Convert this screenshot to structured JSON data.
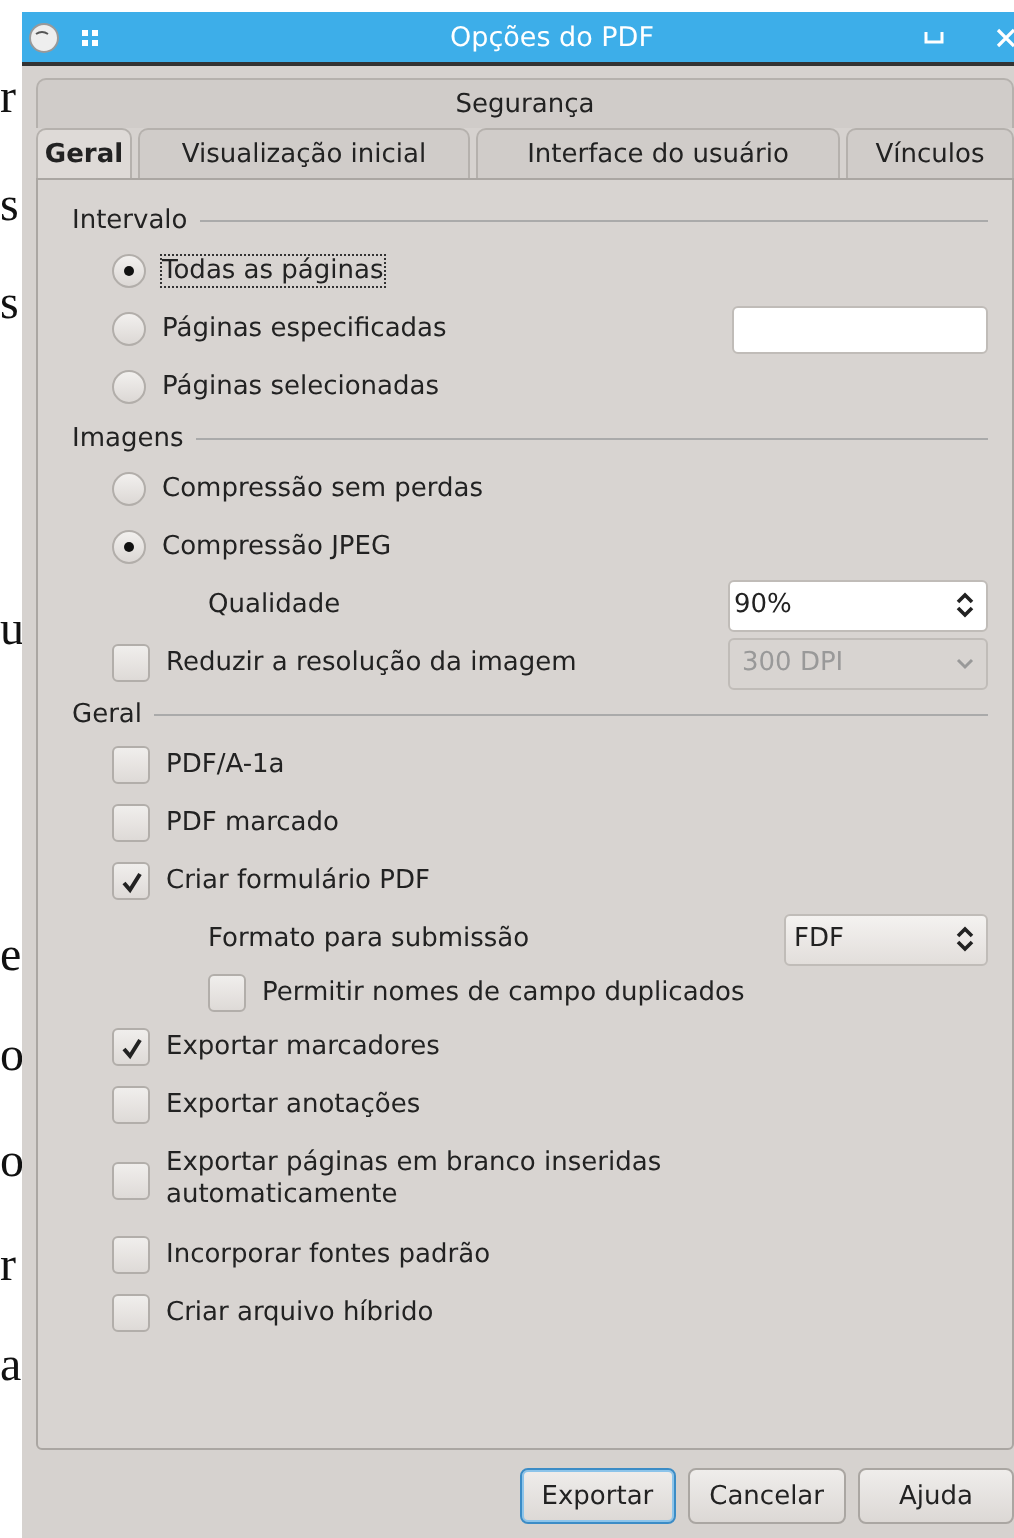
{
  "background_document": {
    "fragments": [
      {
        "text": "r",
        "bold": false
      },
      {
        "text": "s",
        "bold": false
      },
      {
        "text": "s",
        "bold": false
      },
      {
        "text": "u",
        "bold": false
      },
      {
        "text": "e",
        "bold": false
      },
      {
        "text": "o",
        "bold": false
      },
      {
        "text": "o",
        "bold": false
      },
      {
        "text": "r",
        "bold": false
      },
      {
        "text": "a",
        "bold": false
      }
    ]
  },
  "window": {
    "title": "Opções do PDF"
  },
  "tabs": [
    {
      "row": [
        {
          "label": "Segurança",
          "selected": false
        }
      ]
    },
    {
      "row": [
        {
          "label": "Geral",
          "selected": true
        },
        {
          "label": "Visualização inicial",
          "selected": false
        },
        {
          "label": "Interface do usuário",
          "selected": false
        },
        {
          "label": "Vínculos",
          "selected": false
        }
      ]
    }
  ],
  "sections": [
    {
      "title": "Intervalo",
      "items": [
        {
          "kind": "radio",
          "label": "Todas as páginas",
          "selected": true,
          "focused": true
        },
        {
          "kind": "radio",
          "label": "Páginas especificadas",
          "selected": false,
          "focused": false,
          "field": {
            "kind": "text"
          }
        },
        {
          "kind": "radio",
          "label": "Páginas selecionadas",
          "selected": false,
          "focused": false
        }
      ]
    },
    {
      "title": "Imagens",
      "items": [
        {
          "kind": "radio",
          "label": "Compressão sem perdas",
          "selected": false,
          "focused": false
        },
        {
          "kind": "radio",
          "label": "Compressão JPEG",
          "selected": true,
          "focused": false,
          "children": [
            {
              "kind": "spin",
              "label": "Qualidade",
              "value": "90%"
            }
          ]
        },
        {
          "kind": "checkbox",
          "label": "Reduzir a resolução da imagem",
          "checked": false,
          "select": {
            "value": "300 DPI",
            "disabled": true
          }
        }
      ]
    },
    {
      "title": "Geral",
      "items": [
        {
          "kind": "checkbox",
          "label": "PDF/A-1a",
          "checked": false
        },
        {
          "kind": "checkbox",
          "label": "PDF marcado",
          "checked": false
        },
        {
          "kind": "checkbox",
          "label": "Criar formulário PDF",
          "checked": true,
          "children": [
            {
              "kind": "select",
              "label": "Formato para submissão",
              "value": "FDF"
            },
            {
              "kind": "checkbox",
              "label": "Permitir nomes de campo duplicados",
              "checked": false
            }
          ]
        },
        {
          "kind": "checkbox",
          "label": "Exportar marcadores",
          "checked": true
        },
        {
          "kind": "checkbox",
          "label": "Exportar anotações",
          "checked": false
        },
        {
          "kind": "checkbox",
          "label": "Exportar páginas em branco inseridas automaticamente",
          "checked": false
        },
        {
          "kind": "checkbox",
          "label": "Incorporar fontes padrão",
          "checked": false
        },
        {
          "kind": "checkbox",
          "label": "Criar arquivo híbrido",
          "checked": false
        }
      ]
    }
  ],
  "buttons": [
    {
      "label": "Exportar",
      "default": true
    },
    {
      "label": "Cancelar",
      "default": false
    },
    {
      "label": "Ajuda",
      "default": false
    }
  ]
}
